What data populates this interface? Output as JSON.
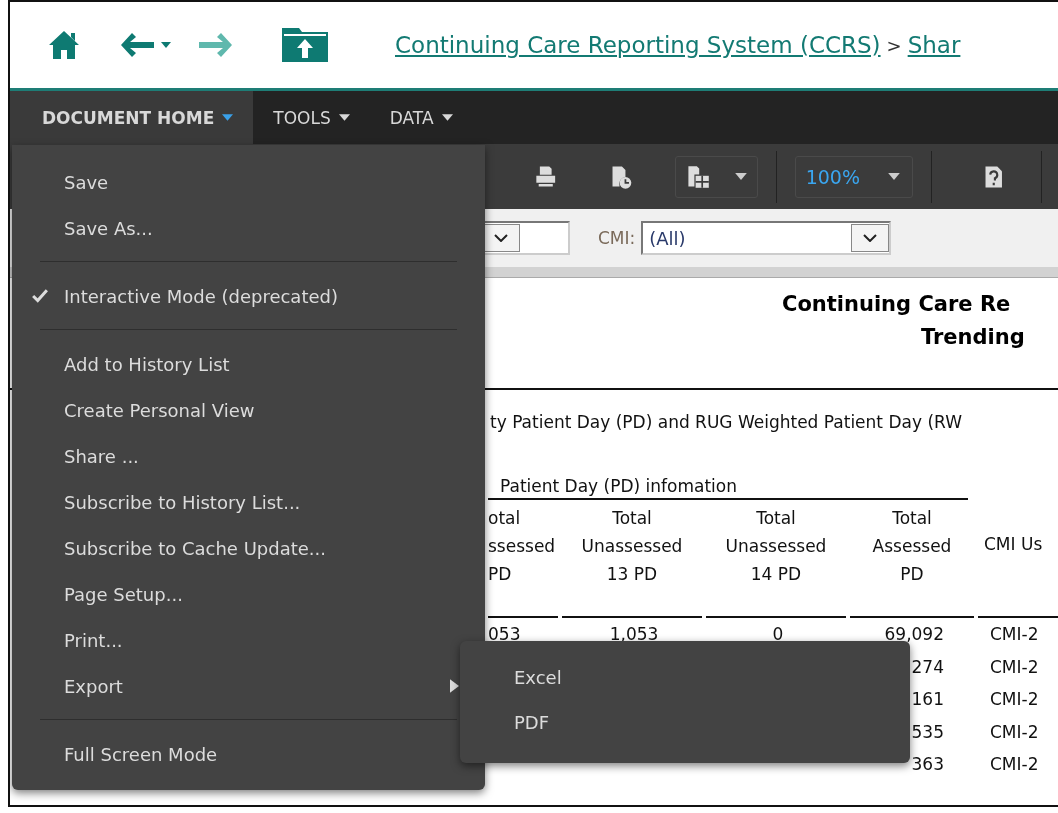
{
  "breadcrumb": [
    {
      "label": "Continuing Care Reporting System (CCRS)",
      "kind": "link"
    },
    {
      "label": ">",
      "kind": "separator"
    },
    {
      "label": "Shar",
      "kind": "link"
    }
  ],
  "menu_bar": [
    {
      "label": "DOCUMENT HOME",
      "selected": true
    },
    {
      "label": "TOOLS",
      "selected": false
    },
    {
      "label": "DATA",
      "selected": false
    }
  ],
  "toolbar": {
    "zoom": "100%"
  },
  "filter": {
    "label": "CMI:",
    "value": "(All)"
  },
  "report": {
    "title_lines": [
      "Continuing Care Re",
      "Trending"
    ],
    "description": "ty Patient Day (PD) and RUG Weighted Patient Day (RW",
    "group_header": "Patient Day (PD) infomation",
    "columns": [
      {
        "lines": [
          "otal",
          "ssessed",
          "PD"
        ]
      },
      {
        "lines": [
          "Total",
          "Unassessed",
          "13 PD"
        ]
      },
      {
        "lines": [
          "Total",
          "Unassessed",
          "14 PD"
        ]
      },
      {
        "lines": [
          "Total",
          "Assessed",
          "PD"
        ]
      },
      {
        "lines": [
          "CMI Us"
        ]
      }
    ],
    "rows": [
      [
        "053",
        "1,053",
        "0",
        "69,092",
        "CMI-2"
      ],
      [
        null,
        null,
        null,
        "274",
        "CMI-2"
      ],
      [
        null,
        null,
        null,
        "161",
        "CMI-2"
      ],
      [
        null,
        null,
        null,
        "535",
        "CMI-2"
      ],
      [
        null,
        null,
        null,
        "363",
        "CMI-2"
      ]
    ]
  },
  "menu": {
    "groups": [
      [
        {
          "label": "Save",
          "kind": "item",
          "checked": false
        },
        {
          "label": "Save As...",
          "kind": "item",
          "checked": false
        }
      ],
      [
        {
          "label": "Interactive Mode (deprecated)",
          "kind": "item",
          "checked": true
        }
      ],
      [
        {
          "label": "Add to History List",
          "kind": "item",
          "checked": false
        },
        {
          "label": "Create Personal View",
          "kind": "item",
          "checked": false
        },
        {
          "label": "Share ...",
          "kind": "item",
          "checked": false
        },
        {
          "label": "Subscribe to History List...",
          "kind": "item",
          "checked": false
        },
        {
          "label": "Subscribe to Cache Update...",
          "kind": "item",
          "checked": false
        },
        {
          "label": "Page Setup...",
          "kind": "item",
          "checked": false
        },
        {
          "label": "Print...",
          "kind": "item",
          "checked": false
        },
        {
          "label": "Export",
          "kind": "submenu",
          "checked": false,
          "expanded": true,
          "children": [
            {
              "label": "Excel"
            },
            {
              "label": "PDF"
            }
          ]
        }
      ],
      [
        {
          "label": "Full Screen Mode",
          "kind": "item",
          "checked": false
        }
      ]
    ]
  }
}
